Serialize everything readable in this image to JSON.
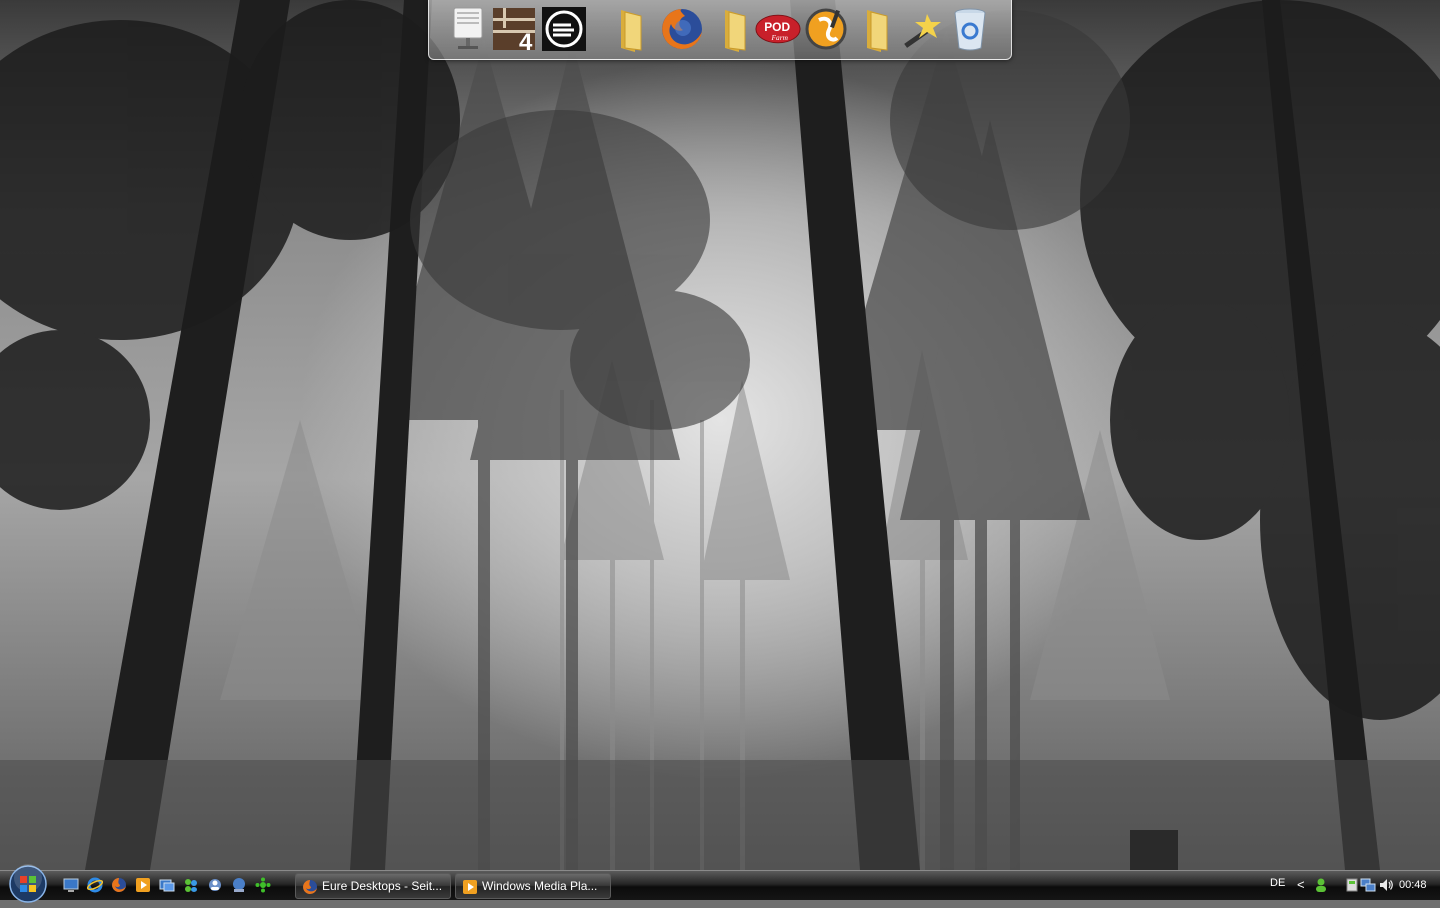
{
  "desktop": {
    "wallpaper": "foggy-forest-wallpaper"
  },
  "dock": {
    "items": [
      {
        "name": "network-monitor-icon"
      },
      {
        "name": "left4dead-icon"
      },
      {
        "name": "circular-app-icon"
      },
      {
        "name": "folder-icon"
      },
      {
        "name": "firefox-icon"
      },
      {
        "name": "folder-icon"
      },
      {
        "name": "podfarm-icon",
        "label": "POD",
        "sublabel": "Farm"
      },
      {
        "name": "fl-studio-icon"
      },
      {
        "name": "folder-icon"
      },
      {
        "name": "magic-wand-icon"
      },
      {
        "name": "recycle-bin-icon"
      }
    ]
  },
  "taskbar": {
    "start_button": "windows-start-orb",
    "quick_launch": [
      "show-desktop-icon",
      "internet-explorer-icon",
      "firefox-icon",
      "media-player-icon",
      "window-switcher-icon",
      "messenger-icon",
      "contacts-icon",
      "network-icon",
      "green-app-icon"
    ],
    "tasks": [
      {
        "label": "Eure Desktops - Seit...",
        "icon": "firefox-icon"
      },
      {
        "label": "Windows Media Pla...",
        "icon": "media-player-icon"
      }
    ],
    "tray": {
      "language": "DE",
      "expand_arrow": "<",
      "icons": [
        "messenger-status-icon",
        "device-icon",
        "network-connection-icon",
        "volume-icon"
      ],
      "clock": "00:48"
    }
  },
  "colors": {
    "taskbar_bg": "#1a1a1a",
    "folder_yellow": "#e8c45a",
    "firefox_orange": "#e8751a",
    "podfarm_red": "#c8202a"
  }
}
